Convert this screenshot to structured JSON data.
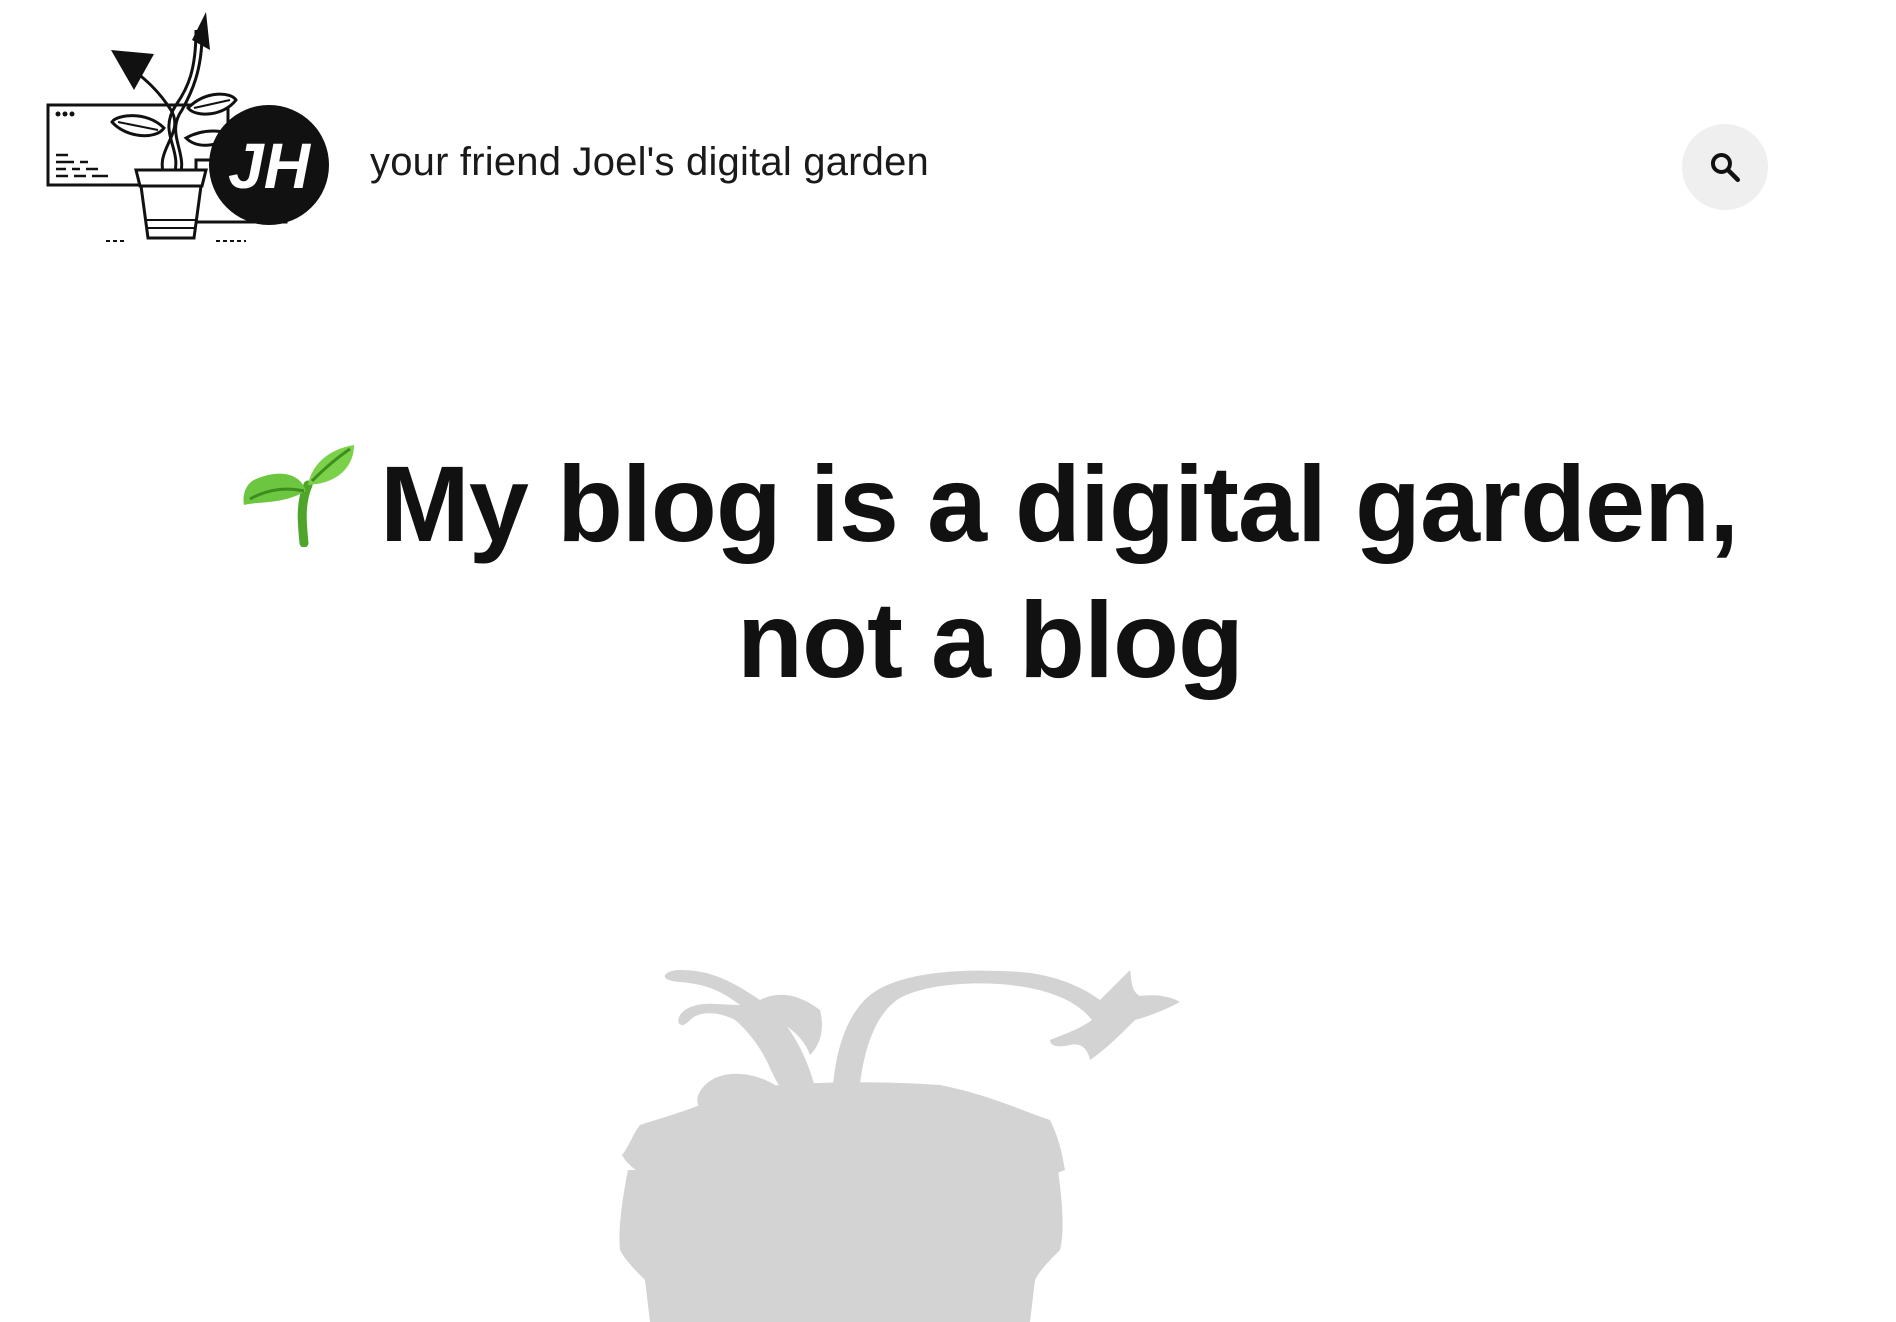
{
  "header": {
    "logo_text": "JH",
    "site_title": "your friend Joel's digital garden",
    "search_icon": "search-icon"
  },
  "article": {
    "emoji": "sprout-icon",
    "title": "My blog is a digital garden, not a blog"
  },
  "hero": {
    "image": "plant-silhouette-illustration"
  },
  "colors": {
    "text": "#111111",
    "search_bg": "#efefef",
    "silhouette": "#d3d3d3",
    "sprout": "#5bb531"
  }
}
